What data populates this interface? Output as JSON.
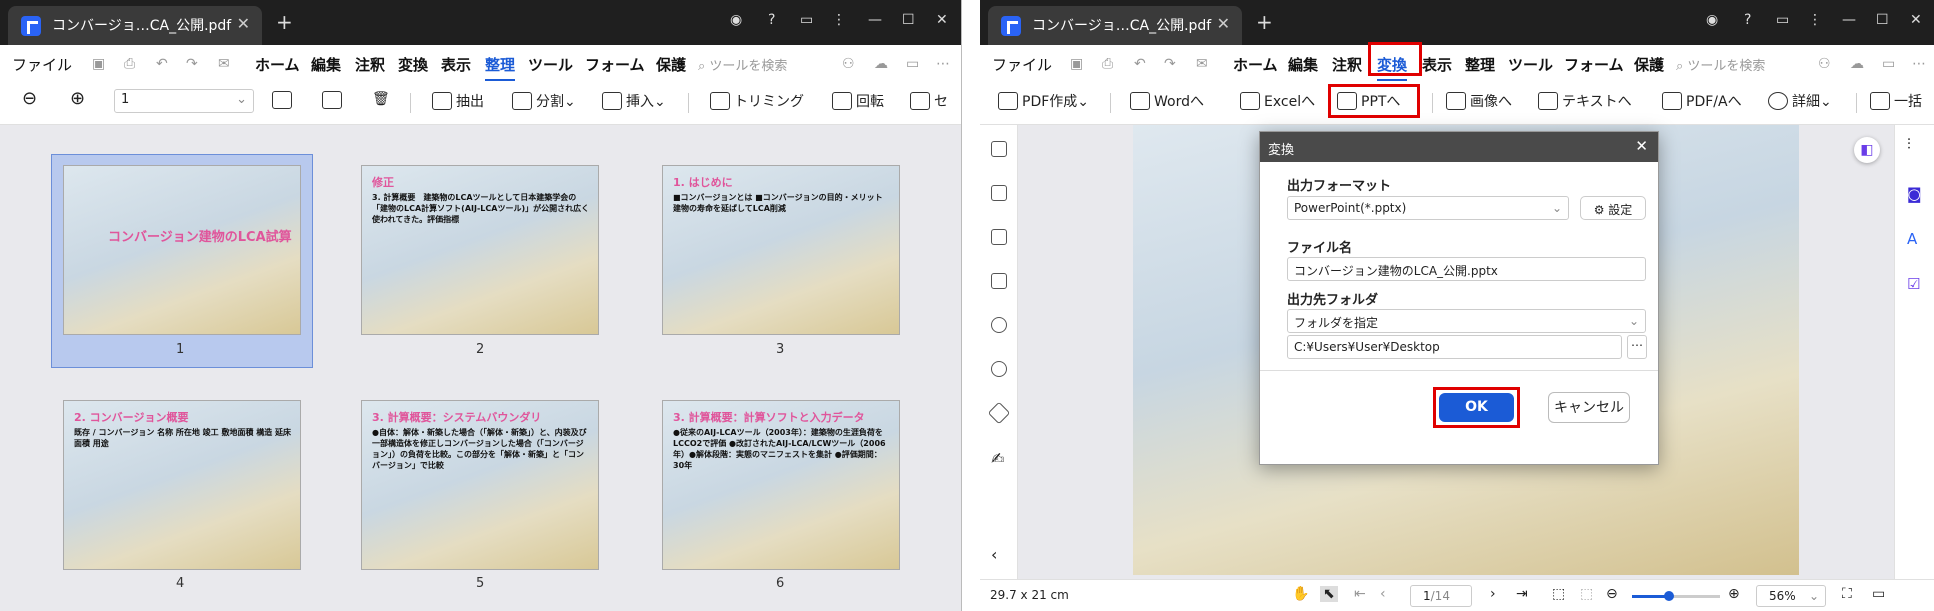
{
  "left": {
    "tab_title": "コンバージョ…CA_公開.pdf",
    "menu": [
      "ファイル",
      "ホーム",
      "編集",
      "注釈",
      "変換",
      "表示",
      "整理",
      "ツール",
      "フォーム",
      "保護"
    ],
    "active_menu": "整理",
    "search_placeholder": "ツールを検索",
    "page_input": "1",
    "toolbar": {
      "extract": "抽出",
      "split": "分割",
      "insert": "挿入",
      "trim": "トリミング",
      "rotate": "回転",
      "more": "セ"
    },
    "pages": [
      {
        "num": "1",
        "title": "コンバージョン建物のLCA試算",
        "text": ""
      },
      {
        "num": "2",
        "title": "修正",
        "text": "3. 計算概要　建築物のLCAツールとして日本建築学会の「建物のLCA計算ソフト(AIJ-LCAツール)」が公開され広く使われてきた。評価指標"
      },
      {
        "num": "3",
        "title": "1. はじめに",
        "text": "■コンバージョンとは ■コンバージョンの目的・メリット 建物の寿命を延ばしてLCA削減"
      },
      {
        "num": "4",
        "title": "2. コンバージョン概要",
        "text": "既存 / コンバージョン 名称 所在地 竣工 敷地面積 構造 延床面積 用途"
      },
      {
        "num": "5",
        "title": "3. 計算概要：システムバウンダリ",
        "text": "●自体：解体・新築した場合（「解体・新築」）と、内装及び一部構造体を修正しコンバージョンした場合（「コンバージョン」）の負荷を比較。この部分を「解体・新築」と「コンバージョン」で比較"
      },
      {
        "num": "6",
        "title": "3. 計算概要：計算ソフトと入力データ",
        "text": "●従来のAIJ-LCAツール（2003年）：建築物の生涯負荷をLCCO2で評価 ●改訂されたAIJ-LCA/LCWツール（2006年）●解体段階：実態のマニフェストを集計 ●評価期間：30年"
      }
    ]
  },
  "right": {
    "tab_title": "コンバージョ…CA_公開.pdf",
    "menu": [
      "ファイル",
      "ホーム",
      "編集",
      "注釈",
      "変換",
      "表示",
      "整理",
      "ツール",
      "フォーム",
      "保護"
    ],
    "active_menu": "変換",
    "search_placeholder": "ツールを検索",
    "toolbar": {
      "pdf_create": "PDF作成",
      "word": "Wordへ",
      "excel": "Excelへ",
      "ppt": "PPTへ",
      "image": "画像へ",
      "text": "テキストへ",
      "pdfa": "PDF/Aへ",
      "more": "詳細",
      "batch": "一括"
    },
    "status": {
      "size": "29.7 x 21 cm",
      "page_current": "1",
      "page_total": "/14",
      "zoom": "56%"
    },
    "dialog": {
      "title": "変換",
      "format_label": "出力フォーマット",
      "format_value": "PowerPoint(*.pptx)",
      "settings": "設定",
      "filename_label": "ファイル名",
      "filename_value": "コンバージョン建物のLCA_公開.pptx",
      "folder_label": "出力先フォルダ",
      "folder_select": "フォルダを指定",
      "folder_path": "C:¥Users¥User¥Desktop",
      "ok": "OK",
      "cancel": "キャンセル"
    }
  },
  "colors": {
    "accent": "#1b5bd6",
    "highlight": "#e00000",
    "title_bar": "#1f1f1f"
  }
}
